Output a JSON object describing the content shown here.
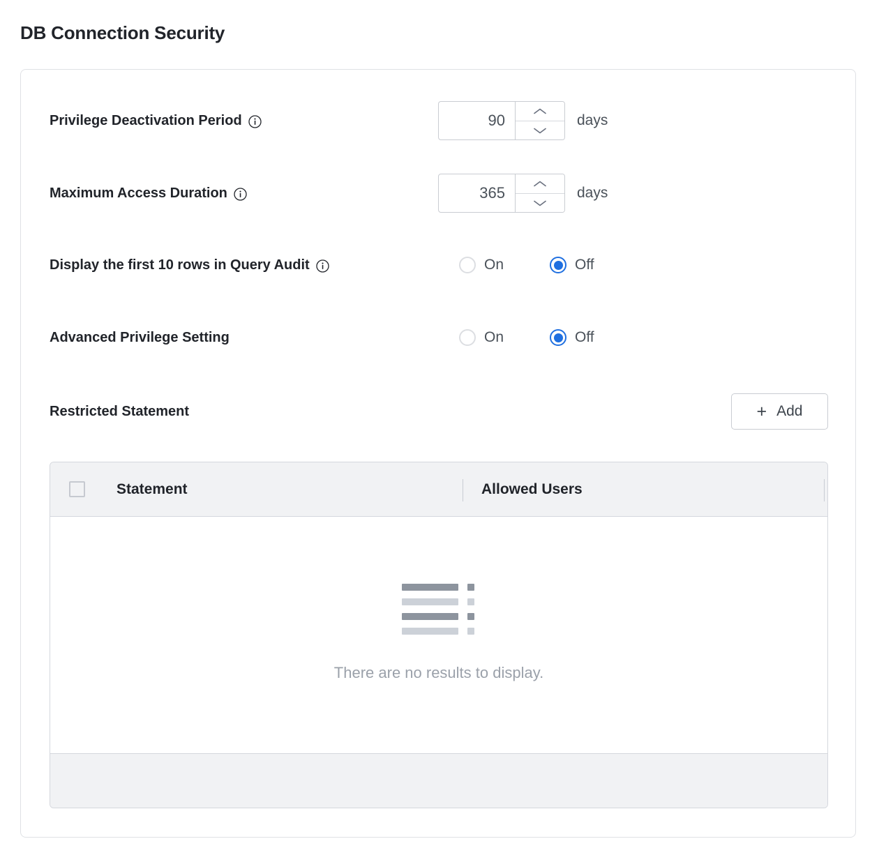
{
  "page": {
    "title": "DB Connection Security"
  },
  "settings": [
    {
      "label": "Privilege Deactivation Period",
      "has_info_icon": true,
      "control": "stepper",
      "value": "90",
      "unit": "days"
    },
    {
      "label": "Maximum Access Duration",
      "has_info_icon": true,
      "control": "stepper",
      "value": "365",
      "unit": "days"
    },
    {
      "label": "Display the first 10 rows in Query Audit",
      "has_info_icon": true,
      "control": "radio",
      "options": [
        "On",
        "Off"
      ],
      "selected": "Off"
    },
    {
      "label": "Advanced Privilege Setting",
      "has_info_icon": false,
      "control": "radio",
      "options": [
        "On",
        "Off"
      ],
      "selected": "Off"
    }
  ],
  "restricted_statement": {
    "title": "Restricted Statement",
    "add_button": {
      "label": "Add",
      "icon": "plus-icon"
    },
    "table": {
      "columns": [
        "Statement",
        "Allowed Users"
      ],
      "select_all_checked": false,
      "rows": [],
      "empty_message": "There are no results to display.",
      "empty_icon": "empty-list-icon"
    }
  },
  "colors": {
    "accent": "#1f6fe0",
    "text_primary": "#21242a",
    "text_secondary": "#4a5159",
    "text_muted": "#9ba1aa",
    "border": "#d4d7dd",
    "card_border": "#dfe1e5",
    "header_bg": "#f1f2f4",
    "icon_dark": "#8d949e",
    "icon_light": "#ccd1d8"
  }
}
